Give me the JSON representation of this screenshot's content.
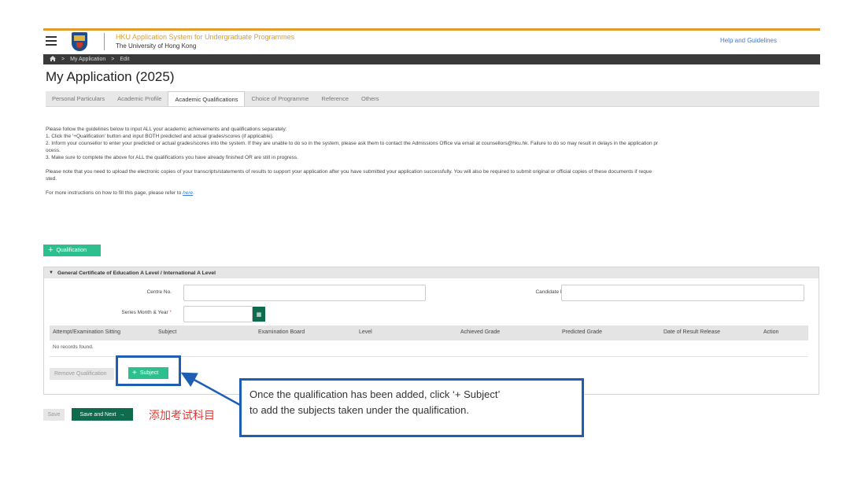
{
  "header": {
    "system_title": "HKU Application System for Undergraduate Programmes",
    "university": "The University of Hong Kong",
    "help_link": "Help and Guidelines"
  },
  "breadcrumb": {
    "home_icon": "home-icon",
    "separator": ">",
    "items": [
      "My Application",
      "Edit"
    ]
  },
  "page": {
    "title": "My Application (2025)"
  },
  "tabs": [
    {
      "label": "Personal Particulars",
      "active": false
    },
    {
      "label": "Academic Profile",
      "active": false
    },
    {
      "label": "Academic Qualifications",
      "active": true
    },
    {
      "label": "Choice of Programme",
      "active": false
    },
    {
      "label": "Reference",
      "active": false
    },
    {
      "label": "Others",
      "active": false
    }
  ],
  "instructions": {
    "intro": "Please follow the guidelines below to input ALL your academic achievements and qualifications separately:",
    "step1": "1. Click the '+Qualification' button and input BOTH predicted and actual grades/scores (if applicable).",
    "step2": "2. Inform your counsellor to enter your predicted or actual grades/scores into the system. If they are unable to do so in the system, please ask them to contact the Admissions Office via email at counsellors@hku.hk. Failure to do so may result in delays in the application pr",
    "step2_cont": "ocess.",
    "step3": "3. Make sure to complete the above for ALL the qualifications you have already finished OR are still in progress.",
    "upload_note": "Please note that you need to upload the electronic copies of your transcripts/statements of results to support your application after you have submitted your application successfully. You will also be required to submit original or official copies of these documents if reque",
    "upload_note_cont": "sted.",
    "more_info_prefix": "For more instructions on how to fill this page, please refer to ",
    "more_info_link": "here",
    "more_info_suffix": "."
  },
  "qualification_button": "Qualification",
  "panel": {
    "title": "General Certificate of Education A Level / International A Level",
    "centre_no_label": "Centre No.",
    "candidate_no_label": "Candidate No.",
    "series_label": "Series Month & Year",
    "required_mark": "*",
    "calendar_icon": "calendar-icon",
    "columns": [
      "Attempt/Examination Sitting",
      "Subject",
      "Examination Board",
      "Level",
      "Achieved Grade",
      "Predicted Grade",
      "Date of Result Release",
      "Action"
    ],
    "empty_text": "No records found.",
    "remove_button": "Remove Qualification",
    "subject_button": "Subject"
  },
  "footer": {
    "save": "Save",
    "save_next": "Save and Next",
    "cn_note": "添加考试科目"
  },
  "callout": {
    "line1": "Once the qualification has been added, click ‘+ Subject’",
    "line2": "to add the subjects taken under the qualification."
  },
  "colors": {
    "accent_orange": "#e09d2c",
    "green": "#2dbf8e",
    "dark_green": "#0e6b4e",
    "callout_blue": "#1e5fb4",
    "note_red": "#e53935"
  }
}
